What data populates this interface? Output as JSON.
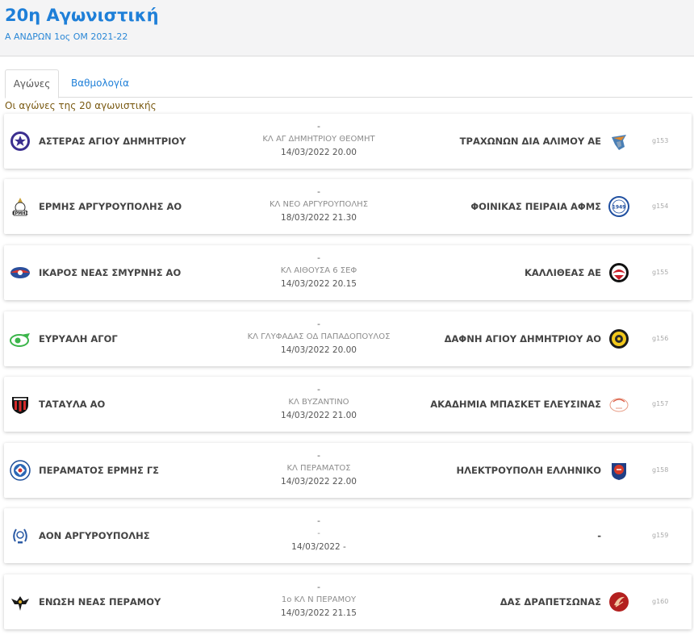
{
  "header": {
    "title": "20η Αγωνιστική",
    "subtitle": "Α ΑΝΔΡΩΝ 1ος ΟΜ 2021-22"
  },
  "tabs": [
    {
      "label": "Αγώνες"
    },
    {
      "label": "Βαθμολογία"
    }
  ],
  "caption": "Οι αγώνες της 20 αγωνιστικής",
  "matches": [
    {
      "home": "ΑΣΤΕΡΑΣ ΑΓΙΟΥ ΔΗΜΗΤΡΙΟΥ",
      "score": "-",
      "venue": "ΚΛ ΑΓ ΔΗΜΗΤΡΙΟΥ ΘΕΟΜΗΤ",
      "datetime": "14/03/2022 20.00",
      "away": "ΤΡΑΧΩΝΩΝ ΔΙΑ ΑΛΙΜΟΥ ΑΕ",
      "code": "g153",
      "home_logo_icon": "star-crest-icon",
      "away_logo_icon": "eagle-shield-icon"
    },
    {
      "home": "ΕΡΜΗΣ ΑΡΓΥΡΟΥΠΟΛΗΣ ΑΟ",
      "score": "-",
      "venue": "ΚΛ ΝΕΟ ΑΡΓΥΡΟΥΠΟΛΗΣ",
      "datetime": "18/03/2022 21.30",
      "away": "ΦΟΙΝΙΚΑΣ ΠΕΙΡΑΙΑ ΑΦΜΣ",
      "code": "g154",
      "home_logo_icon": "hermes-crest-icon",
      "away_logo_icon": "phoenix-1949-badge-icon"
    },
    {
      "home": "ΙΚΑΡΟΣ ΝΕΑΣ ΣΜΥΡΝΗΣ ΑΟ",
      "score": "-",
      "venue": "ΚΛ ΑΙΘΟΥΣΑ 6 ΣΕΦ",
      "datetime": "14/03/2022 20.15",
      "away": "ΚΑΛΛΙΘΕΑΣ ΑΕ",
      "code": "g155",
      "home_logo_icon": "ikaros-ball-icon",
      "away_logo_icon": "kallithea-crest-icon"
    },
    {
      "home": "ΕΥΡΥΑΛΗ ΑΓΟΓ",
      "score": "-",
      "venue": "ΚΛ ΓΛΥΦΑΔΑΣ ΟΔ ΠΑΠΑΔΟΠΟΥΛΟΣ",
      "datetime": "14/03/2022 20.00",
      "away": "ΔΑΦΝΗ ΑΓΙΟΥ ΔΗΜΗΤΡΙΟΥ ΑΟ",
      "code": "g156",
      "home_logo_icon": "evryali-green-icon",
      "away_logo_icon": "dafni-yellow-crest-icon"
    },
    {
      "home": "ΤΑΤΑΥΛΑ ΑΟ",
      "score": "-",
      "venue": "ΚΛ ΒΥΖΑΝΤΙΝΟ",
      "datetime": "14/03/2022 21.00",
      "away": "ΑΚΑΔΗΜΙΑ ΜΠΑΣΚΕΤ ΕΛΕΥΣΙΝΑΣ",
      "code": "g157",
      "home_logo_icon": "tatavla-shield-icon",
      "away_logo_icon": "academy-ball-icon"
    },
    {
      "home": "ΠΕΡΑΜΑΤΟΣ ΕΡΜΗΣ ΓΣ",
      "score": "-",
      "venue": "ΚΛ ΠΕΡΑΜΑΤΟΣ",
      "datetime": "14/03/2022 22.00",
      "away": "ΗΛΕΚΤΡΟΥΠΟΛΗ ΕΛΛΗΝΙΚΟ",
      "code": "g158",
      "home_logo_icon": "perama-blue-crest-icon",
      "away_logo_icon": "ilektroupoli-badge-icon"
    },
    {
      "home": "ΑΟΝ ΑΡΓΥΡΟΥΠΟΛΗΣ",
      "score": "-",
      "venue": "-",
      "datetime": "14/03/2022 -",
      "away": "-",
      "code": "g159",
      "home_logo_icon": "aon-laurel-icon",
      "away_logo_icon": ""
    },
    {
      "home": "ΕΝΩΣΗ ΝΕΑΣ ΠΕΡΑΜΟΥ",
      "score": "-",
      "venue": "1ο ΚΛ Ν ΠΕΡΑΜΟΥ",
      "datetime": "14/03/2022 21.15",
      "away": "ΔΑΣ ΔΡΑΠΕΤΣΩΝΑΣ",
      "code": "g160",
      "home_logo_icon": "double-eagle-icon",
      "away_logo_icon": "drapetsona-red-icon"
    }
  ]
}
